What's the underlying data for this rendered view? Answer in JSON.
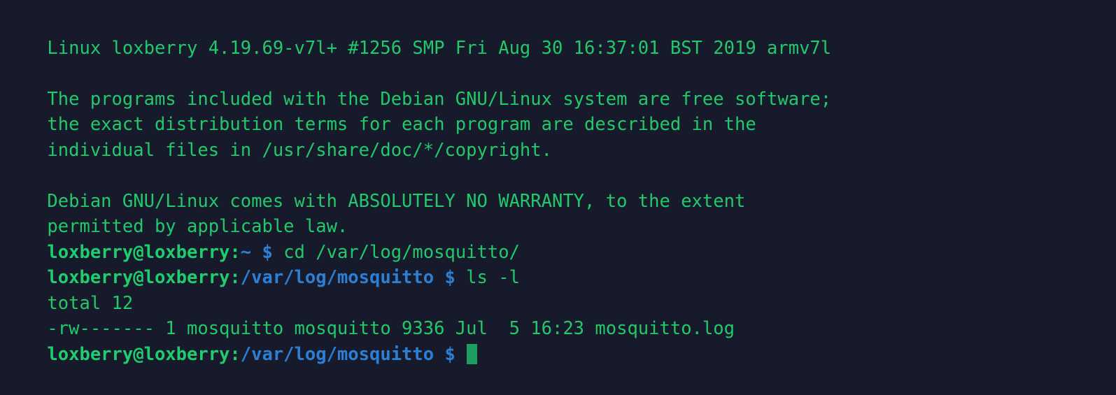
{
  "terminal": {
    "background_color": "#171a2b",
    "text_color": "#21c96b",
    "path_color": "#2b7fd4",
    "cursor_color": "#1f9e63",
    "lines": [
      {
        "id": "uname",
        "text": "Linux loxberry 4.19.69-v7l+ #1256 SMP Fri Aug 30 16:37:01 BST 2019 armv7l"
      },
      {
        "id": "blank-1",
        "text": ""
      },
      {
        "id": "motd-1",
        "text": "The programs included with the Debian GNU/Linux system are free software;"
      },
      {
        "id": "motd-2",
        "text": "the exact distribution terms for each program are described in the"
      },
      {
        "id": "motd-3",
        "text": "individual files in /usr/share/doc/*/copyright."
      },
      {
        "id": "blank-2",
        "text": ""
      },
      {
        "id": "warranty-1",
        "text": "Debian GNU/Linux comes with ABSOLUTELY NO WARRANTY, to the extent"
      },
      {
        "id": "warranty-2",
        "text": "permitted by applicable law."
      },
      {
        "id": "total",
        "text": "total 12"
      },
      {
        "id": "listing",
        "text": "-rw------- 1 mosquitto mosquitto 9336 Jul  5 16:23 mosquitto.log"
      }
    ],
    "prompts": {
      "prompt_1": {
        "user_host": "loxberry@loxberry:",
        "path": "~",
        "sigil": " $ ",
        "command": "cd /var/log/mosquitto/"
      },
      "prompt_2": {
        "user_host": "loxberry@loxberry:",
        "path": "/var/log/mosquitto",
        "sigil": " $ ",
        "command": "ls -l"
      },
      "prompt_3": {
        "user_host": "loxberry@loxberry:",
        "path": "/var/log/mosquitto",
        "sigil": " $ ",
        "command": ""
      }
    }
  }
}
